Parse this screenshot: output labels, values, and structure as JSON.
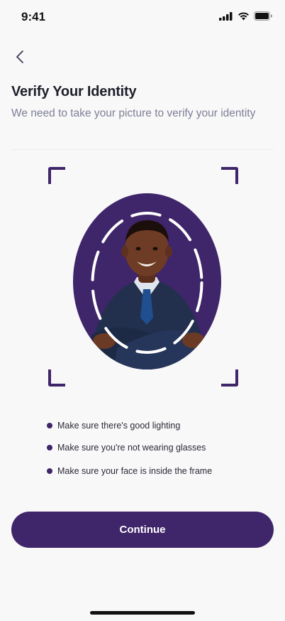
{
  "status_bar": {
    "time": "9:41",
    "icons": [
      "signal-icon",
      "wifi-icon",
      "battery-icon"
    ]
  },
  "header": {
    "back_icon": "chevron-left-icon",
    "title": "Verify Your Identity",
    "subtitle": "We need to take your picture  to verify your identity"
  },
  "camera": {
    "frame_color": "#3f2569",
    "oval_color": "#3f2569",
    "guide_color": "#ffffff"
  },
  "tips": [
    "Make sure there's good lighting",
    "Make sure you're not wearing glasses",
    "Make sure your face is inside the frame"
  ],
  "actions": {
    "continue_label": "Continue"
  },
  "colors": {
    "accent": "#3f2569",
    "background": "#f8f8f9",
    "subtitle": "#7d7f95"
  }
}
